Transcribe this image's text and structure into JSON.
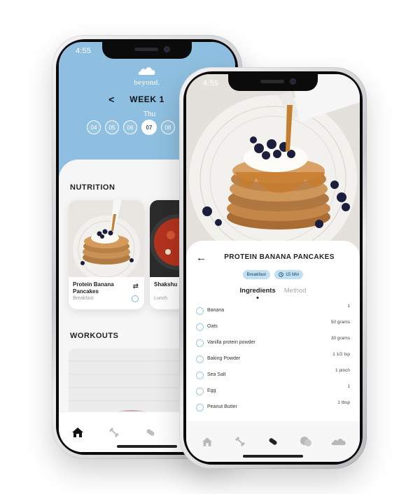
{
  "back_phone": {
    "status_time": "4:55",
    "brand": "beyond.",
    "week": {
      "prev_label": "<",
      "label": "WEEK 1"
    },
    "day_name": "Thu",
    "days": [
      "04",
      "05",
      "06",
      "07",
      "08"
    ],
    "active_day": "07",
    "nutrition": {
      "title": "NUTRITION",
      "cards": [
        {
          "name": "Protein Banana Pancakes",
          "tag": "Breakfast"
        },
        {
          "name": "Shakshu",
          "tag": "Lunch"
        }
      ]
    },
    "workouts": {
      "title": "WORKOUTS"
    },
    "tabs": [
      "home-icon",
      "dumbbell-icon",
      "pill-icon"
    ]
  },
  "front_phone": {
    "status_time": "4:55",
    "recipe": {
      "back_label": "←",
      "title": "PROTEIN BANANA PANCAKES",
      "chips": [
        {
          "label": "Breakfast"
        },
        {
          "label": "15 Min",
          "icon": "clock-icon"
        }
      ],
      "tabs": {
        "active": "Ingredients",
        "inactive": "Method"
      },
      "ingredients": [
        {
          "name": "Banana",
          "qty": "1"
        },
        {
          "name": "Oats",
          "qty": "50 grams"
        },
        {
          "name": "Vanilla protein powder",
          "qty": "30 grams"
        },
        {
          "name": "Baking Powder",
          "qty": "1 1/2 tsp"
        },
        {
          "name": "Sea Salt",
          "qty": "1 pinch"
        },
        {
          "name": "Egg",
          "qty": "1"
        },
        {
          "name": "Peanut Butter",
          "qty": "1 tbsp"
        }
      ]
    },
    "tabs": [
      "home-icon",
      "dumbbell-icon",
      "pill-icon",
      "chat-icon",
      "cloud-icon"
    ]
  },
  "colors": {
    "header_blue": "#8fbfe0",
    "chip_blue": "#bfe0f2",
    "checkbox_blue": "#9cc9e4"
  }
}
